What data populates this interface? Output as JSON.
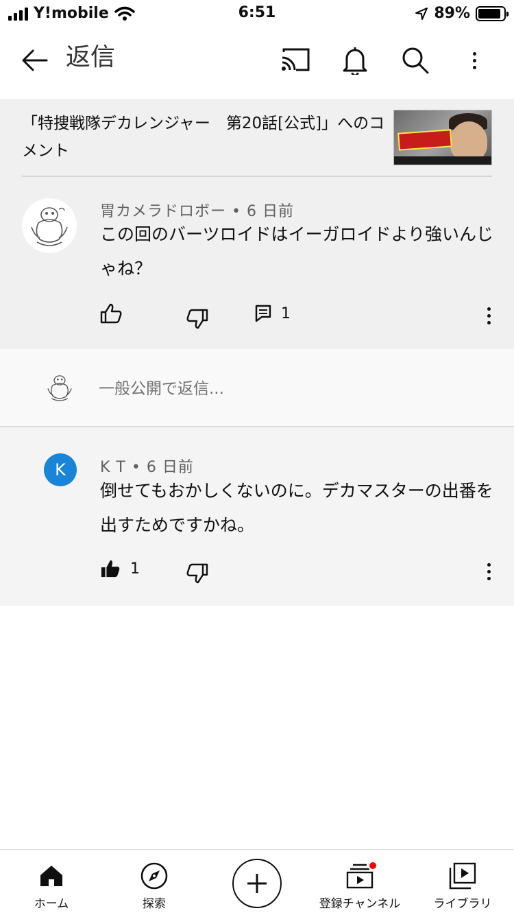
{
  "status_bar": {
    "carrier": "Y!mobile",
    "time": "6:51",
    "battery_percent": "89%",
    "battery_level": 0.89
  },
  "header": {
    "title": "返信",
    "icons": [
      "back-arrow-icon",
      "cast-icon",
      "bell-icon",
      "search-icon",
      "more-vert-icon"
    ]
  },
  "video": {
    "reference_text": "「特捜戦隊デカレンジャー　第20話[公式]」へのコメント"
  },
  "top_comment": {
    "author": "胃カメラドロボー",
    "age": "6 日前",
    "text": "この回のバーツロイドはイーガロイドより強いんじゃね？",
    "reply_count": "1"
  },
  "reply_input": {
    "placeholder": "一般公開で返信..."
  },
  "reply_comment": {
    "avatar_letter": "K",
    "author": "K T",
    "age": "6 日前",
    "text": "倒せてもおかしくないのに。デカマスターの出番を出すためですかね。",
    "like_count": "1"
  },
  "bottom_nav": {
    "home": "ホーム",
    "explore": "探索",
    "subscriptions": "登録チャンネル",
    "library": "ライブラリ"
  }
}
